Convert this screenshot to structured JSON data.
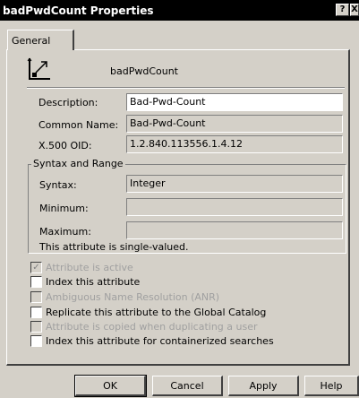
{
  "window": {
    "title": "badPwdCount Properties",
    "help_glyph": "?",
    "close_glyph": "X"
  },
  "tabs": [
    {
      "label": "General"
    }
  ],
  "header": {
    "attribute_name": "badPwdCount"
  },
  "fields": {
    "description": {
      "label": "Description:",
      "value": "Bad-Pwd-Count"
    },
    "common_name": {
      "label": "Common Name:",
      "value": "Bad-Pwd-Count"
    },
    "oid": {
      "label": "X.500 OID:",
      "value": "1.2.840.113556.1.4.12"
    }
  },
  "syntax_group": {
    "title": "Syntax and Range",
    "syntax": {
      "label": "Syntax:",
      "value": "Integer"
    },
    "minimum": {
      "label": "Minimum:",
      "value": ""
    },
    "maximum": {
      "label": "Maximum:",
      "value": ""
    },
    "note": "This attribute is single-valued."
  },
  "options": [
    {
      "label": "Attribute is active",
      "checked": true,
      "enabled": false
    },
    {
      "label": "Index this attribute",
      "checked": false,
      "enabled": true
    },
    {
      "label": "Ambiguous Name Resolution (ANR)",
      "checked": false,
      "enabled": false
    },
    {
      "label": "Replicate this attribute to the Global Catalog",
      "checked": false,
      "enabled": true
    },
    {
      "label": "Attribute is copied when duplicating a user",
      "checked": false,
      "enabled": false
    },
    {
      "label": "Index this attribute for containerized searches",
      "checked": false,
      "enabled": true
    }
  ],
  "buttons": {
    "ok": "OK",
    "cancel": "Cancel",
    "apply": "Apply",
    "help": "Help"
  },
  "icons": {
    "attribute": "attribute-icon"
  }
}
